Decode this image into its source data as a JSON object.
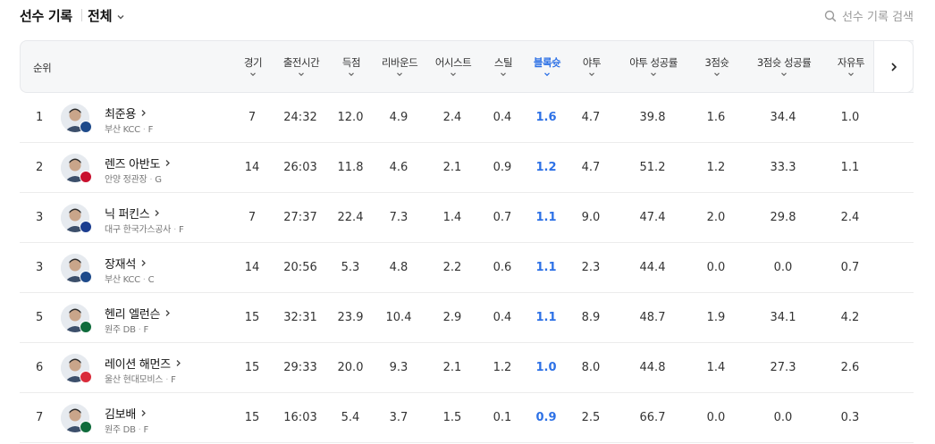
{
  "header": {
    "title": "선수 기록",
    "filter": "전체",
    "search_placeholder": "선수 기록 검색"
  },
  "columns": {
    "rank": "순위",
    "games": "경기",
    "minutes": "출전시간",
    "points": "득점",
    "rebounds": "리바운드",
    "assists": "어시스트",
    "steals": "스틸",
    "blocks": "블록슛",
    "fg": "야투",
    "fg_pct": "야투 성공률",
    "three": "3점슛",
    "three_pct": "3점슛 성공률",
    "ft": "자유투"
  },
  "accent_color": "#2d71e6",
  "players": [
    {
      "rank": "1",
      "name": "최준용",
      "team": "부산 KCC",
      "pos": "F",
      "team_color": "#1e4a8a",
      "games": "7",
      "minutes": "24:32",
      "points": "12.0",
      "rebounds": "4.9",
      "assists": "2.4",
      "steals": "0.4",
      "blocks": "1.6",
      "fg": "4.7",
      "fg_pct": "39.8",
      "three": "1.6",
      "three_pct": "34.4",
      "ft": "1.0"
    },
    {
      "rank": "2",
      "name": "렌즈 아반도",
      "team": "안양 정관장",
      "pos": "G",
      "team_color": "#c8102e",
      "games": "14",
      "minutes": "26:03",
      "points": "11.8",
      "rebounds": "4.6",
      "assists": "2.1",
      "steals": "0.9",
      "blocks": "1.2",
      "fg": "4.7",
      "fg_pct": "51.2",
      "three": "1.2",
      "three_pct": "33.3",
      "ft": "1.1"
    },
    {
      "rank": "3",
      "name": "닉 퍼킨스",
      "team": "대구 한국가스공사",
      "pos": "F",
      "team_color": "#1b3d8f",
      "games": "7",
      "minutes": "27:37",
      "points": "22.4",
      "rebounds": "7.3",
      "assists": "1.4",
      "steals": "0.7",
      "blocks": "1.1",
      "fg": "9.0",
      "fg_pct": "47.4",
      "three": "2.0",
      "three_pct": "29.8",
      "ft": "2.4"
    },
    {
      "rank": "3",
      "name": "장재석",
      "team": "부산 KCC",
      "pos": "C",
      "team_color": "#1e4a8a",
      "games": "14",
      "minutes": "20:56",
      "points": "5.3",
      "rebounds": "4.8",
      "assists": "2.2",
      "steals": "0.6",
      "blocks": "1.1",
      "fg": "2.3",
      "fg_pct": "44.4",
      "three": "0.0",
      "three_pct": "0.0",
      "ft": "0.7"
    },
    {
      "rank": "5",
      "name": "헨리 엘런슨",
      "team": "원주 DB",
      "pos": "F",
      "team_color": "#0f6b3b",
      "games": "15",
      "minutes": "32:31",
      "points": "23.9",
      "rebounds": "10.4",
      "assists": "2.9",
      "steals": "0.4",
      "blocks": "1.1",
      "fg": "8.9",
      "fg_pct": "48.7",
      "three": "1.9",
      "three_pct": "34.1",
      "ft": "4.2"
    },
    {
      "rank": "6",
      "name": "레이션 해먼즈",
      "team": "울산 현대모비스",
      "pos": "F",
      "team_color": "#d92b3a",
      "games": "15",
      "minutes": "29:33",
      "points": "20.0",
      "rebounds": "9.3",
      "assists": "2.1",
      "steals": "1.2",
      "blocks": "1.0",
      "fg": "8.0",
      "fg_pct": "44.8",
      "three": "1.4",
      "three_pct": "27.3",
      "ft": "2.6"
    },
    {
      "rank": "7",
      "name": "김보배",
      "team": "원주 DB",
      "pos": "F",
      "team_color": "#0f6b3b",
      "games": "15",
      "minutes": "16:03",
      "points": "5.4",
      "rebounds": "3.7",
      "assists": "1.5",
      "steals": "0.1",
      "blocks": "0.9",
      "fg": "2.5",
      "fg_pct": "66.7",
      "three": "0.0",
      "three_pct": "0.0",
      "ft": "0.3"
    }
  ]
}
